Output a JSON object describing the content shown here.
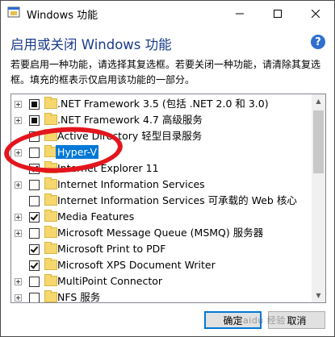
{
  "window": {
    "title": "Windows 功能",
    "minimize_icon": "minimize-icon",
    "maximize_icon": "maximize-icon",
    "close_icon": "close-icon"
  },
  "header": {
    "title": "启用或关闭 Windows 功能",
    "help_label": "?"
  },
  "description": "若要启用一种功能，请选择其复选框。若要关闭一种功能，请清除其复选框。填充的框表示仅启用该功能的一部分。",
  "features": [
    {
      "label": ".NET Framework 3.5 (包括 .NET 2.0 和 3.0)",
      "state": "partial",
      "expandable": true,
      "selected": false
    },
    {
      "label": ".NET Framework 4.7 高级服务",
      "state": "partial",
      "expandable": true,
      "selected": false
    },
    {
      "label": "Active Directory 轻型目录服务",
      "state": "unchecked",
      "expandable": false,
      "selected": false
    },
    {
      "label": "Hyper-V",
      "state": "unchecked",
      "expandable": true,
      "selected": true
    },
    {
      "label": "Internet Explorer 11",
      "state": "checked",
      "expandable": false,
      "selected": false
    },
    {
      "label": "Internet Information Services",
      "state": "unchecked",
      "expandable": true,
      "selected": false
    },
    {
      "label": "Internet Information Services 可承载的 Web 核心",
      "state": "unchecked",
      "expandable": false,
      "selected": false
    },
    {
      "label": "Media Features",
      "state": "checked",
      "expandable": true,
      "selected": false
    },
    {
      "label": "Microsoft Message Queue (MSMQ) 服务器",
      "state": "unchecked",
      "expandable": true,
      "selected": false
    },
    {
      "label": "Microsoft Print to PDF",
      "state": "checked",
      "expandable": false,
      "selected": false
    },
    {
      "label": "Microsoft XPS Document Writer",
      "state": "checked",
      "expandable": false,
      "selected": false
    },
    {
      "label": "MultiPoint Connector",
      "state": "unchecked",
      "expandable": true,
      "selected": false
    },
    {
      "label": "NFS 服务",
      "state": "unchecked",
      "expandable": true,
      "selected": false
    }
  ],
  "buttons": {
    "ok": "确定",
    "cancel": "取消"
  },
  "annotation": {
    "highlight_color": "#e3151d"
  },
  "colors": {
    "header_text": "#1a3b8a",
    "selection": "#0078d7",
    "folder": "#f5d76e"
  }
}
